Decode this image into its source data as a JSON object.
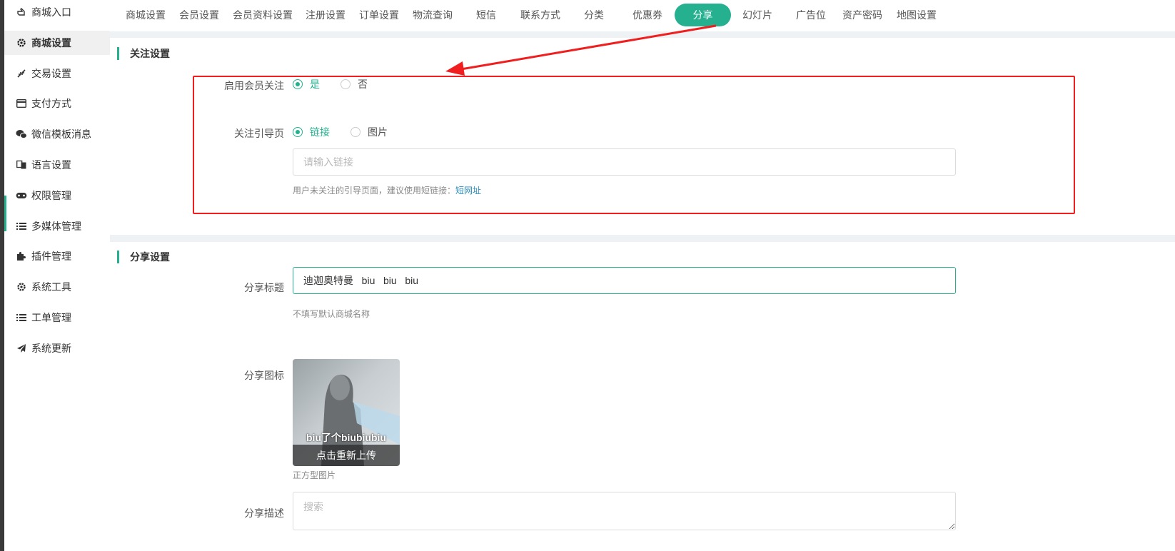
{
  "sidebar": {
    "items": [
      {
        "label": "商城入口",
        "icon": "hand-point-icon"
      },
      {
        "label": "商城设置",
        "icon": "gear-icon",
        "active": true
      },
      {
        "label": "交易设置",
        "icon": "compress-arrows-icon"
      },
      {
        "label": "支付方式",
        "icon": "credit-card-icon"
      },
      {
        "label": "微信模板消息",
        "icon": "wechat-icon"
      },
      {
        "label": "语言设置",
        "icon": "translate-icon"
      },
      {
        "label": "权限管理",
        "icon": "gamepad-icon"
      },
      {
        "label": "多媒体管理",
        "icon": "list-icon"
      },
      {
        "label": "插件管理",
        "icon": "puzzle-icon"
      },
      {
        "label": "系统工具",
        "icon": "gear-icon"
      },
      {
        "label": "工单管理",
        "icon": "list-icon"
      },
      {
        "label": "系统更新",
        "icon": "paper-plane-icon"
      }
    ]
  },
  "tabs": [
    {
      "label": "商城设置"
    },
    {
      "label": "会员设置"
    },
    {
      "label": "会员资料设置"
    },
    {
      "label": "注册设置"
    },
    {
      "label": "订单设置"
    },
    {
      "label": "物流查询"
    },
    {
      "label": "短信"
    },
    {
      "label": "联系方式"
    },
    {
      "label": "分类"
    },
    {
      "label": "优惠券"
    },
    {
      "label": "分享",
      "active": true
    },
    {
      "label": "幻灯片"
    },
    {
      "label": "广告位"
    },
    {
      "label": "资产密码"
    },
    {
      "label": "地图设置"
    }
  ],
  "follow": {
    "title": "关注设置",
    "enable_label": "启用会员关注",
    "enable_options": [
      {
        "label": "是",
        "selected": true
      },
      {
        "label": "否",
        "selected": false
      }
    ],
    "guide_label": "关注引导页",
    "guide_options": [
      {
        "label": "链接",
        "selected": true
      },
      {
        "label": "图片",
        "selected": false
      }
    ],
    "link_placeholder": "请输入链接",
    "hint_text": "用户未关注的引导页面，建议使用短链接：",
    "hint_link": "短网址"
  },
  "share": {
    "title": "分享设置",
    "title_label": "分享标题",
    "title_value": "迪迦奥特曼   biu   biu   biu",
    "title_hint": "不填写默认商城名称",
    "icon_label": "分享图标",
    "icon_meme_text": "biu了个biubiubiu",
    "icon_reupload": "点击重新上传",
    "icon_hint": "正方型图片",
    "desc_label": "分享描述",
    "desc_placeholder": "搜索"
  },
  "colors": {
    "accent": "#25b08f",
    "annotation": "#f01e1e",
    "link": "#2a8fbd"
  }
}
